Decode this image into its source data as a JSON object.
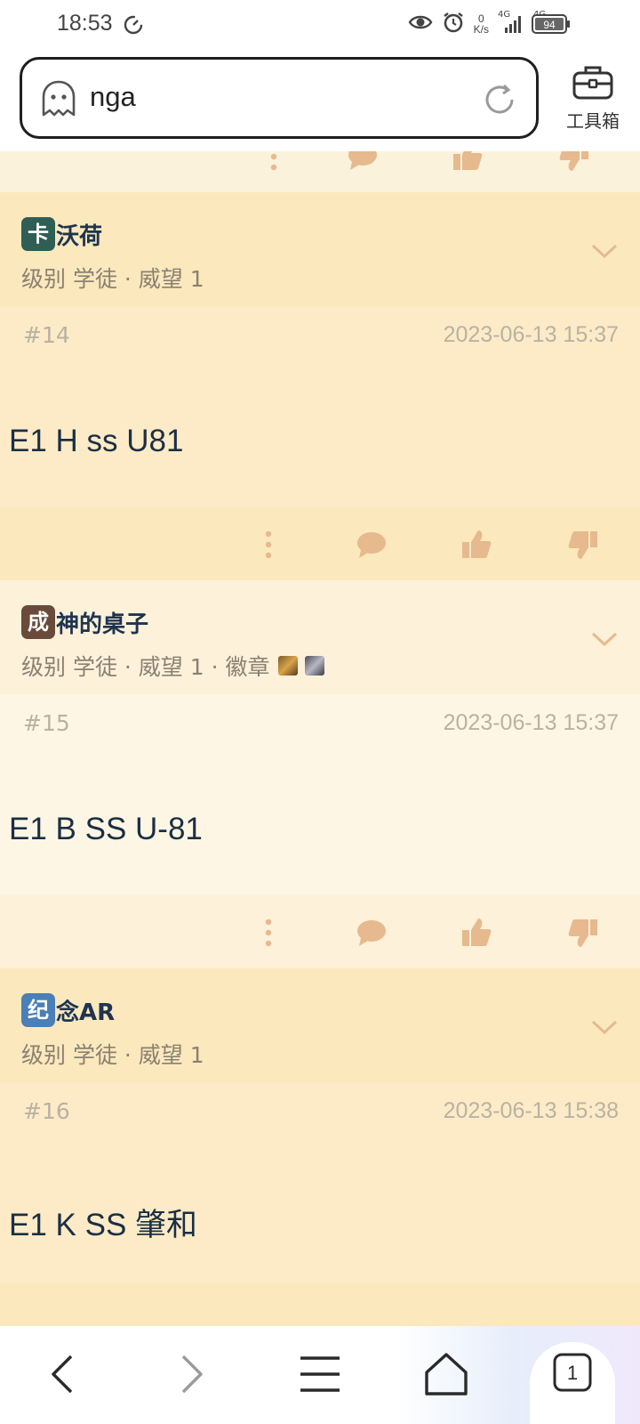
{
  "status_bar": {
    "time": "18:53",
    "net_speed_value": "0",
    "net_speed_unit": "K/s",
    "signal_1": "4G",
    "signal_2": "4G",
    "battery": "94"
  },
  "address_bar": {
    "url": "nga",
    "toolbox_label": "工具箱"
  },
  "posts": [
    {
      "avatar_char": "卡",
      "avatar_color": "#2f5e55",
      "username": "沃荷",
      "meta": "级别 学徒 · 威望 1",
      "floor": "#14",
      "time": "2023-06-13 15:37",
      "text": "E1 H ss U81",
      "header_bg": "#fbe8bd",
      "body_bg": "#fcebc6"
    },
    {
      "avatar_char": "成",
      "avatar_color": "#6a4a3a",
      "username": "神的桌子",
      "meta": "级别 学徒 · 威望 1 · 徽章",
      "floor": "#15",
      "time": "2023-06-13 15:37",
      "text": "E1 B SS U-81",
      "header_bg": "#fdf1da",
      "body_bg": "#fef6e4"
    },
    {
      "avatar_char": "纪",
      "avatar_color": "#4a7fb8",
      "username": "念AR",
      "meta": "级别 学徒 · 威望 1",
      "floor": "#16",
      "time": "2023-06-13 15:38",
      "text": "E1 K SS 肇和",
      "header_bg": "#fbe8bd",
      "body_bg": "#fcebc6"
    }
  ],
  "bottom_nav": {
    "tab_count": "1"
  },
  "colors": {
    "accent_icon": "#e6b98e",
    "username": "#1e3450",
    "meta": "#8a8172"
  }
}
